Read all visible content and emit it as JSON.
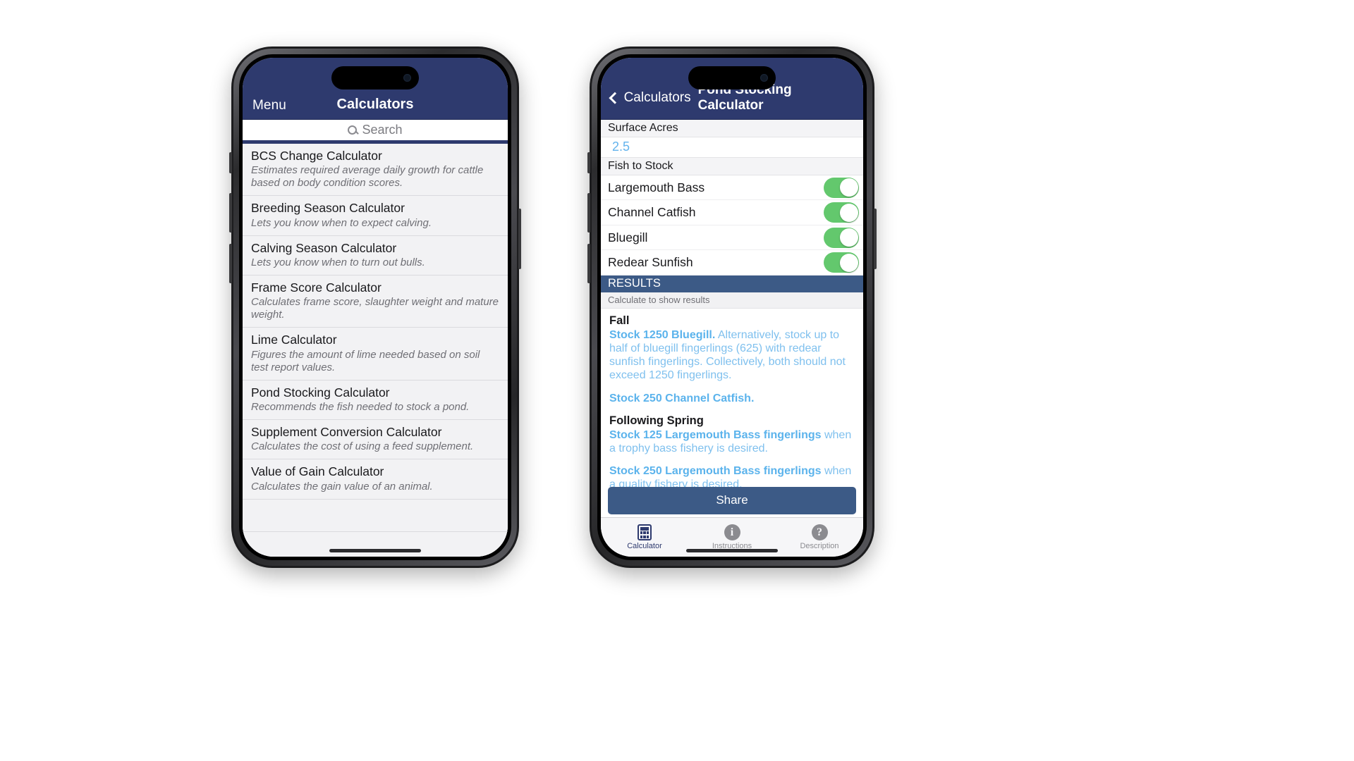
{
  "left_phone": {
    "nav": {
      "menu_label": "Menu",
      "title": "Calculators"
    },
    "search": {
      "placeholder": "Search",
      "icon": "search-icon"
    },
    "calculators": [
      {
        "title": "BCS Change Calculator",
        "desc": "Estimates required average daily growth for cattle based on body condition scores."
      },
      {
        "title": "Breeding Season Calculator",
        "desc": "Lets you know when to expect calving."
      },
      {
        "title": "Calving Season Calculator",
        "desc": "Lets you know when to turn out bulls."
      },
      {
        "title": "Frame Score Calculator",
        "desc": "Calculates frame score,  slaughter weight and mature weight."
      },
      {
        "title": "Lime Calculator",
        "desc": "Figures the amount of lime needed based on soil test report values."
      },
      {
        "title": "Pond Stocking Calculator",
        "desc": "Recommends the fish needed to stock a pond."
      },
      {
        "title": "Supplement Conversion Calculator",
        "desc": "Calculates the cost of using a feed supplement."
      },
      {
        "title": "Value of Gain Calculator",
        "desc": "Calculates the gain value of an animal."
      }
    ]
  },
  "right_phone": {
    "nav": {
      "back_label": "Calculators",
      "title": "Pond Stocking Calculator",
      "back_icon": "chevron-left-icon"
    },
    "form": {
      "surface_acres_label": "Surface Acres",
      "surface_acres_value": "2.5",
      "fish_section_label": "Fish to Stock",
      "fish": [
        {
          "name": "Largemouth Bass",
          "on": true
        },
        {
          "name": "Channel Catfish",
          "on": true
        },
        {
          "name": "Bluegill",
          "on": true
        },
        {
          "name": "Redear Sunfish",
          "on": true
        }
      ]
    },
    "results": {
      "header": "RESULTS",
      "note": "Calculate to show results",
      "fall_heading": "Fall",
      "fall_bluegill_bold": "Stock 1250 Bluegill.",
      "fall_bluegill_rest": " Alternatively, stock up to half of bluegill fingerlings (625) with redear sunfish fingerlings. Collectively, both should not exceed 1250 fingerlings.",
      "fall_catfish_bold": "Stock 250 Channel Catfish.",
      "spring_heading": "Following Spring",
      "spring_trophy_bold": "Stock 125 Largemouth Bass fingerlings",
      "spring_trophy_rest": " when a trophy bass fishery is desired.",
      "spring_quality_bold": "Stock 250 Largemouth Bass fingerlings",
      "spring_quality_rest": " when a quality fishery is desired."
    },
    "share_label": "Share",
    "tabs": [
      {
        "label": "Calculator",
        "icon": "calculator-icon",
        "active": true
      },
      {
        "label": "Instructions",
        "icon": "info-icon",
        "active": false
      },
      {
        "label": "Description",
        "icon": "question-icon",
        "active": false
      }
    ]
  },
  "colors": {
    "navy": "#2e3a6e",
    "results_blue": "#3c5a86",
    "link_blue": "#7fc0ee",
    "value_blue": "#63b3ed",
    "toggle_green": "#63c86d"
  }
}
